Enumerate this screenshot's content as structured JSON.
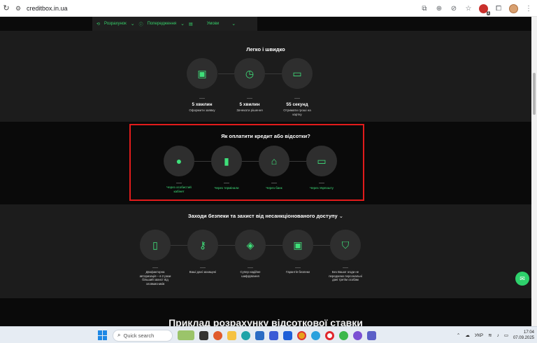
{
  "browser": {
    "url": "creditbox.in.ua"
  },
  "nav": {
    "items": [
      "Розрахунок",
      "Попередження",
      "Умови"
    ]
  },
  "section_fast": {
    "title": "Легко і швидко",
    "steps": [
      {
        "icon": "clipboard-icon",
        "value": "5 хвилин",
        "desc": "Оформити заявку"
      },
      {
        "icon": "clock-icon",
        "value": "5 хвилин",
        "desc": "Зачекати рішення"
      },
      {
        "icon": "money-icon",
        "value": "55 секунд",
        "desc": "Отримати гроші на картку"
      }
    ]
  },
  "section_pay": {
    "title": "Як оплатити кредит або відсотки?",
    "methods": [
      {
        "icon": "user-icon",
        "label": "Через особистий кабінет"
      },
      {
        "icon": "terminal-icon",
        "label": "Через термінали"
      },
      {
        "icon": "bank-icon",
        "label": "Через банк"
      },
      {
        "icon": "laptop-icon",
        "label": "Через Укрпошту"
      }
    ]
  },
  "section_security": {
    "title": "Заходи безпеки та захист від несанкціонованого доступу",
    "items": [
      {
        "icon": "phone-2fa-icon",
        "label": "Двофакторна авторизація – в 2 рази більший захист від зловмисників"
      },
      {
        "icon": "key-icon",
        "label": "Ваші дані захищені"
      },
      {
        "icon": "encryption-icon",
        "label": "Супер надійне шифрування"
      },
      {
        "icon": "lock-icon",
        "label": "Гарантія безпеки"
      },
      {
        "icon": "shield-check-icon",
        "label": "Без Вашої згоди не передаємо персональні дані третім особам"
      }
    ]
  },
  "section_example": {
    "title": "Приклад розрахунку відсоткової ставки"
  },
  "taskbar": {
    "search_placeholder": "Quick search",
    "lang": "УКР",
    "time": "17:04",
    "date": "07.09.2025"
  },
  "colors": {
    "accent": "#3fe07a",
    "highlight": "#e21b1b"
  }
}
